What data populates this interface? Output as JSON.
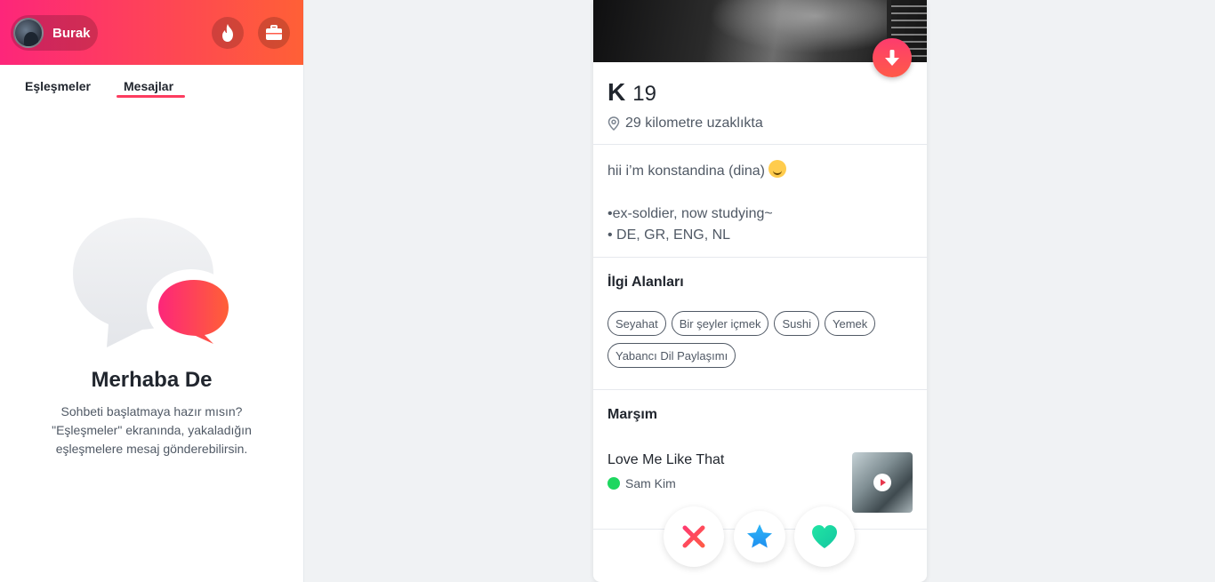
{
  "sidebar": {
    "profile_name": "Burak",
    "tabs": {
      "matches": "Eşleşmeler",
      "messages": "Mesajlar"
    },
    "empty_state": {
      "title": "Merhaba De",
      "body": "Sohbeti başlatmaya hazır mısın? \"Eşleşmeler\" ekranında, yakaladığın eşleşmelere mesaj gönderebilirsin."
    }
  },
  "profile": {
    "name": "K",
    "age": "19",
    "distance": "29 kilometre uzaklıkta",
    "bio_line1": "hii i’m konstandina (dina)",
    "bio_line2": "•ex-soldier, now studying~",
    "bio_line3": "• DE, GR, ENG, NL",
    "interests_title": "İlgi Alanları",
    "interests": [
      "Seyahat",
      "Bir şeyler içmek",
      "Sushi",
      "Yemek",
      "Yabancı Dil Paylaşımı"
    ],
    "anthem_title": "Marşım",
    "anthem": {
      "song": "Love Me Like That",
      "artist": "Sam Kim"
    }
  },
  "colors": {
    "brand_gradient_start": "#fd267a",
    "brand_gradient_end": "#ff6036",
    "nope": "#fd3c5f",
    "super_like": "#2db5f6",
    "like": "#21e5a4"
  },
  "icons": {
    "flame": "flame-icon",
    "briefcase": "briefcase-icon",
    "location": "location-pin-icon",
    "down": "arrow-down-icon",
    "spotify": "spotify-icon",
    "play": "play-icon",
    "nope": "x-icon",
    "super_like": "star-icon",
    "like": "heart-icon"
  }
}
